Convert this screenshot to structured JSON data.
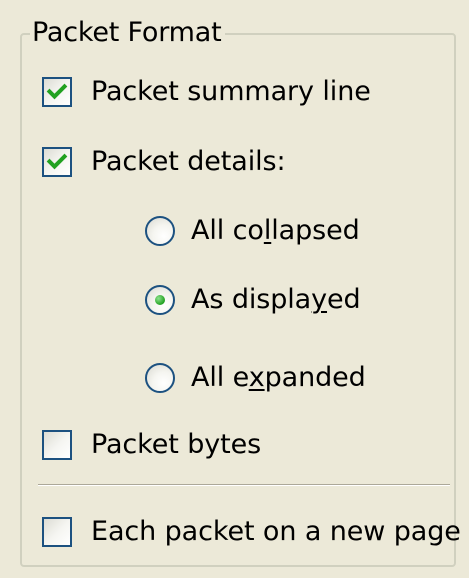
{
  "group": {
    "title": "Packet Format"
  },
  "options": {
    "summary_line": {
      "label": "Packet summary line",
      "checked": true
    },
    "details": {
      "label": "Packet details:",
      "checked": true
    },
    "bytes": {
      "label": "Packet bytes",
      "checked": false
    },
    "new_page": {
      "label": "Each packet on a new page",
      "checked": false
    }
  },
  "details_mode": {
    "selected": "As displayed",
    "all_collapsed": {
      "label": "All collapsed",
      "pre": "All co",
      "mnemonic": "l",
      "post": "lapsed"
    },
    "as_displayed": {
      "label": "As displayed",
      "pre": "As displa",
      "mnemonic": "y",
      "post": "ed"
    },
    "all_expanded": {
      "label": "All expanded",
      "pre": "All e",
      "mnemonic": "x",
      "post": "panded"
    }
  },
  "colors": {
    "dialog_background": "#ece9d8",
    "control_border": "#1c5180",
    "check_mark": "#21a121",
    "groupbox_border": "#d0d0bf"
  },
  "icons": {
    "checked": "check-mark-icon",
    "radio_selected": "radio-dot-icon"
  }
}
